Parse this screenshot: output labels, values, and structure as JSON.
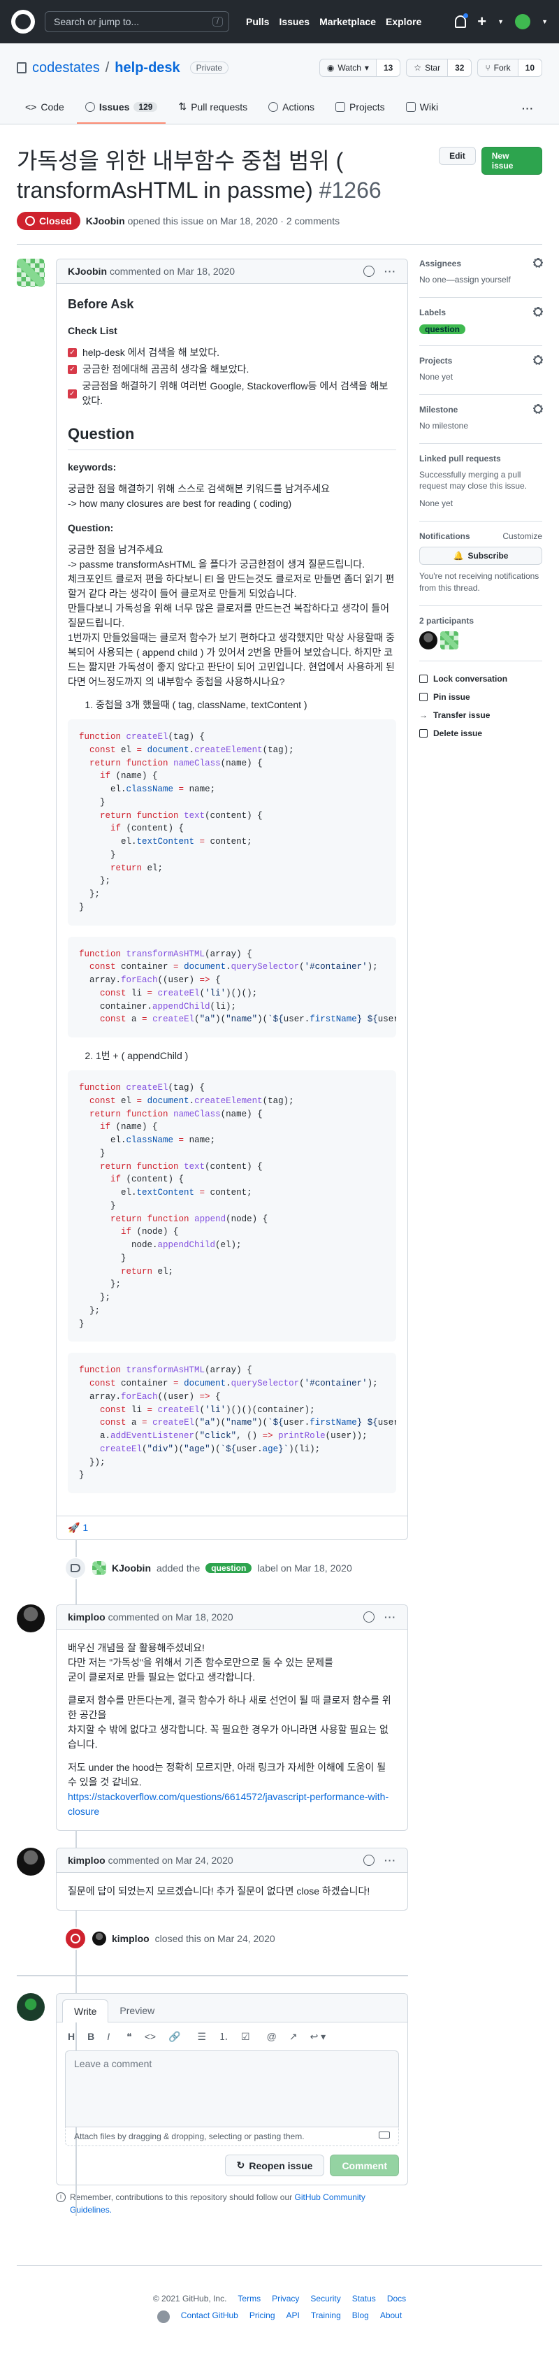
{
  "header": {
    "search_placeholder": "Search or jump to...",
    "search_shortcut": "/",
    "nav": [
      "Pulls",
      "Issues",
      "Marketplace",
      "Explore"
    ]
  },
  "repo": {
    "owner": "codestates",
    "name": "help-desk",
    "visibility": "Private",
    "watch": {
      "label": "Watch",
      "count": "13"
    },
    "star": {
      "label": "Star",
      "count": "32"
    },
    "fork": {
      "label": "Fork",
      "count": "10"
    },
    "tabs": [
      {
        "label": "Code"
      },
      {
        "label": "Issues",
        "count": "129"
      },
      {
        "label": "Pull requests"
      },
      {
        "label": "Actions"
      },
      {
        "label": "Projects"
      },
      {
        "label": "Wiki"
      }
    ]
  },
  "issue": {
    "title": "가독성을 위한 내부함수 중첩 범위 ( transformAsHTML in passme)",
    "number": "#1266",
    "edit_label": "Edit",
    "new_issue_label": "New issue",
    "state": "Closed",
    "author": "KJoobin",
    "opened_text": "opened this issue on Mar 18, 2020 · 2 comments"
  },
  "first_comment": {
    "author": "KJoobin",
    "meta": "commented on Mar 18, 2020",
    "heading": "Before Ask",
    "checklist_heading": "Check List",
    "checklist": [
      "help-desk 에서 검색을 해 보았다.",
      "궁금한 점에대해 곰곰히 생각을 해보았다.",
      "궁금점을 해결하기 위해 여러번 Google, Stackoverflow등 에서 검색을 해보았다."
    ],
    "question_heading": "Question",
    "keywords_heading": "keywords:",
    "keywords_lines": [
      "궁금한 점을 해결하기 위해 스스로 검색해본 키워드를 남겨주세요",
      "-> how many closures are best for reading ( coding)"
    ],
    "question_label": "Question:",
    "question_lines": [
      "궁금한 점을 남겨주세요",
      "-> passme transformAsHTML 을 플다가 궁금한점이 생겨 질문드립니다.",
      "체크포인트 클로저 편을 하다보니 El 을 만드는것도 클로저로 만들면 좀더 읽기 편할거 같다 라는 생각이 들어 클로저로 만들게 되었습니다.",
      "만들다보니 가독성을 위해 너무 많은 클로저를 만드는건 복잡하다고 생각이 들어 질문드립니다.",
      "1번까지 만들었을때는 클로저 함수가 보기 편하다고 생각했지만 막상 사용할때 중복되어 사용되는 ( append child ) 가 있어서 2번을 만들어 보았습니다. 하지만 코드는 짧지만 가독성이 좋지 않다고 판단이 되어 고민입니다. 현업에서 사용하게 된다면 어느정도까지 의 내부함수 중첩을 사용하시나요?"
    ],
    "case1": "중첩을 3개 했을때 ( tag, className, textContent )",
    "case2": "1번 + ( appendChild )",
    "reaction_emoji": "🚀",
    "reaction_count": "1"
  },
  "label_event": {
    "actor": "KJoobin",
    "text_before": "added the",
    "label": "question",
    "text_after": "label on Mar 18, 2020"
  },
  "comment2": {
    "author": "kimploo",
    "meta": "commented on Mar 18, 2020",
    "p1": "배우신 개념을 잘 활용해주셨네요!\n다만 저는 \"가독성\"을 위해서 기존 함수로만으로 둘 수 있는 문제를\n굳이 클로저로 만들 필요는 없다고 생각합니다.",
    "p2": "클로저 함수를 만든다는게, 결국 함수가 하나 새로 선언이 될 때 클로저 함수를 위한 공간을\n차지할 수 밖에 없다고 생각합니다. 꼭 필요한 경우가 아니라면 사용할 필요는 없습니다.",
    "p3": "저도 under the hood는 정확히 모르지만, 아래 링크가 자세한 이해에 도움이 될 수 있을 것 같네요.",
    "link": "https://stackoverflow.com/questions/6614572/javascript-performance-with-closure"
  },
  "comment3": {
    "author": "kimploo",
    "meta": "commented on Mar 24, 2020",
    "text": "질문에 답이 되었는지 모르겠습니다! 추가 질문이 없다면 close 하겠습니다!"
  },
  "close_event": {
    "actor": "kimploo",
    "text": "closed this on Mar 24, 2020"
  },
  "form": {
    "tab_write": "Write",
    "tab_preview": "Preview",
    "placeholder": "Leave a comment",
    "attach_text": "Attach files by dragging & dropping, selecting or pasting them.",
    "reopen_label": "Reopen issue",
    "comment_label": "Comment",
    "remember_text": "Remember, contributions to this repository should follow our",
    "guidelines_link": "GitHub Community Guidelines."
  },
  "sidebar": {
    "assignees_title": "Assignees",
    "assignees_value": "No one—assign yourself",
    "labels_title": "Labels",
    "label_value": "question",
    "projects_title": "Projects",
    "projects_value": "None yet",
    "milestone_title": "Milestone",
    "milestone_value": "No milestone",
    "linked_title": "Linked pull requests",
    "linked_value": "Successfully merging a pull request may close this issue.",
    "linked_none": "None yet",
    "notifications_title": "Notifications",
    "customize_label": "Customize",
    "subscribe_label": "Subscribe",
    "notif_text": "You're not receiving notifications from this thread.",
    "participants_title": "2 participants",
    "actions": [
      "Lock conversation",
      "Pin issue",
      "Transfer issue",
      "Delete issue"
    ]
  },
  "footer": {
    "copyright": "© 2021 GitHub, Inc.",
    "row1": [
      "Terms",
      "Privacy",
      "Security",
      "Status",
      "Docs"
    ],
    "row2": [
      "Contact GitHub",
      "Pricing",
      "API",
      "Training",
      "Blog",
      "About"
    ]
  },
  "colors": {
    "closed_red": "#cf222e",
    "green": "#2da44e",
    "link_blue": "#0969da",
    "header_bg": "#24292f"
  }
}
